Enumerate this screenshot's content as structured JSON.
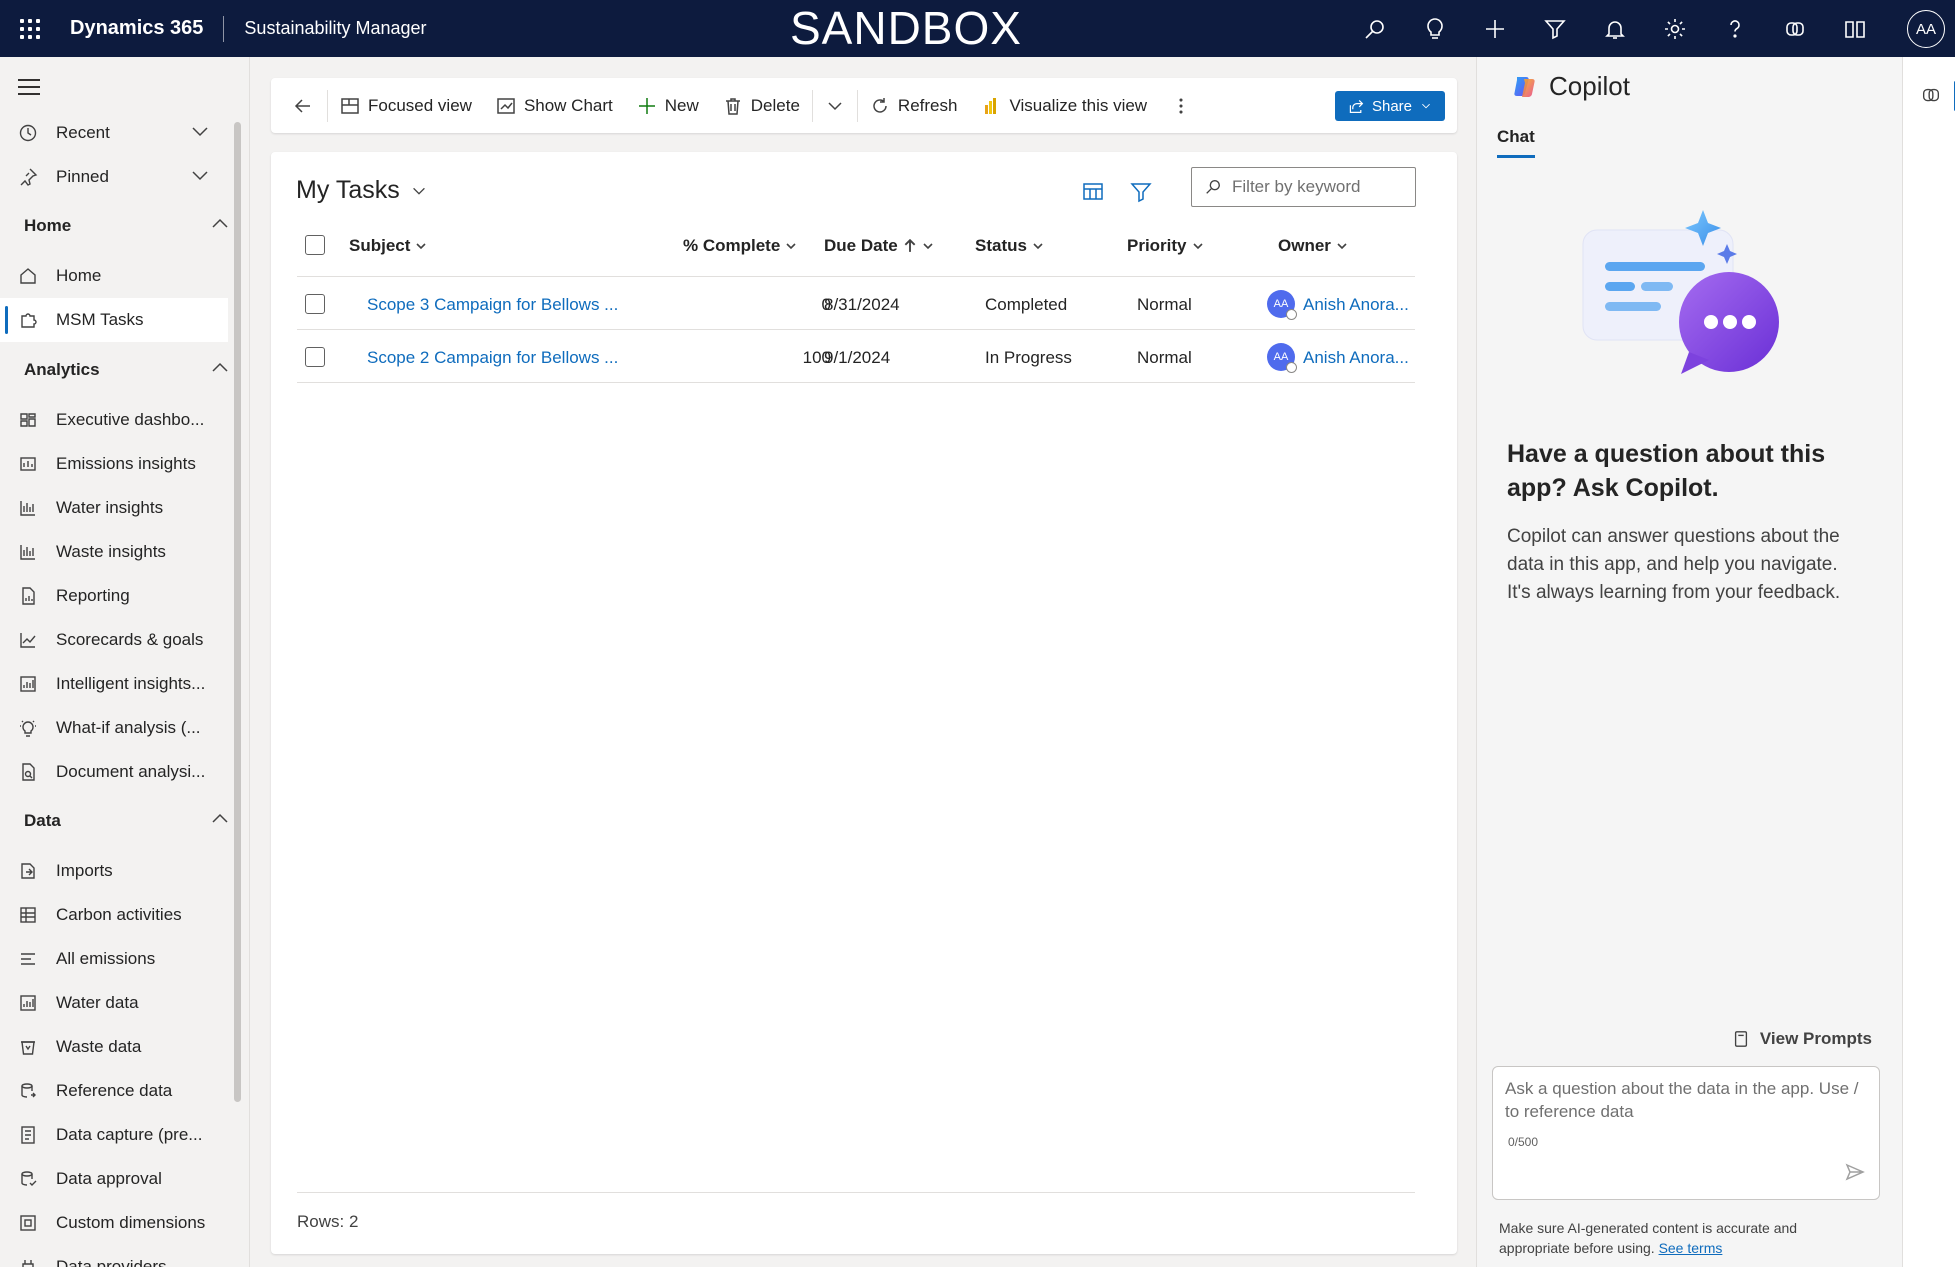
{
  "topbar": {
    "brand": "Dynamics 365",
    "app_name": "Sustainability Manager",
    "environment_banner": "SANDBOX",
    "user_initials": "AA",
    "icons": [
      "search-icon",
      "lightbulb-icon",
      "add-icon",
      "filter-icon",
      "bell-icon",
      "settings-icon",
      "help-icon",
      "copilot-icon",
      "book-icon"
    ]
  },
  "nav": {
    "recent": "Recent",
    "pinned": "Pinned",
    "sections": [
      {
        "title": "Home",
        "items": [
          "Home",
          "MSM Tasks"
        ]
      },
      {
        "title": "Analytics",
        "items": [
          "Executive dashbo...",
          "Emissions insights",
          "Water insights",
          "Waste insights",
          "Reporting",
          "Scorecards & goals",
          "Intelligent insights...",
          "What-if analysis (...",
          "Document analysi..."
        ]
      },
      {
        "title": "Data",
        "items": [
          "Imports",
          "Carbon activities",
          "All emissions",
          "Water data",
          "Waste data",
          "Reference data",
          "Data capture (pre...",
          "Data approval",
          "Custom dimensions",
          "Data providers"
        ]
      }
    ],
    "selected": "MSM Tasks"
  },
  "commandbar": {
    "focused_view": "Focused view",
    "show_chart": "Show Chart",
    "new": "New",
    "delete": "Delete",
    "refresh": "Refresh",
    "visualize": "Visualize this view",
    "share": "Share"
  },
  "grid": {
    "view_title": "My Tasks",
    "filter_placeholder": "Filter by keyword",
    "columns": [
      "Subject",
      "% Complete",
      "Due Date",
      "Status",
      "Priority",
      "Owner"
    ],
    "rows": [
      {
        "subject": "Scope 3 Campaign for Bellows ...",
        "complete": "0",
        "due": "8/31/2024",
        "status": "Completed",
        "priority": "Normal",
        "owner_initials": "AA",
        "owner": "Anish Anora..."
      },
      {
        "subject": "Scope 2 Campaign for Bellows ...",
        "complete": "100",
        "due": "9/1/2024",
        "status": "In Progress",
        "priority": "Normal",
        "owner_initials": "AA",
        "owner": "Anish Anora..."
      }
    ],
    "rows_label": "Rows: 2"
  },
  "copilot": {
    "title": "Copilot",
    "tab": "Chat",
    "question": "Have a question about this app? Ask Copilot.",
    "description": "Copilot can answer questions about the data in this app, and help you navigate. It's always learning from your feedback.",
    "view_prompts": "View Prompts",
    "input_placeholder": "Ask a question about the data in the app. Use / to reference data",
    "char_count": "0/500",
    "disclaimer": "Make sure AI-generated content is accurate and appropriate before using.",
    "see_terms": "See terms"
  },
  "colors": {
    "topbar_bg": "#0d1b3e",
    "accent": "#0f6cbd"
  }
}
